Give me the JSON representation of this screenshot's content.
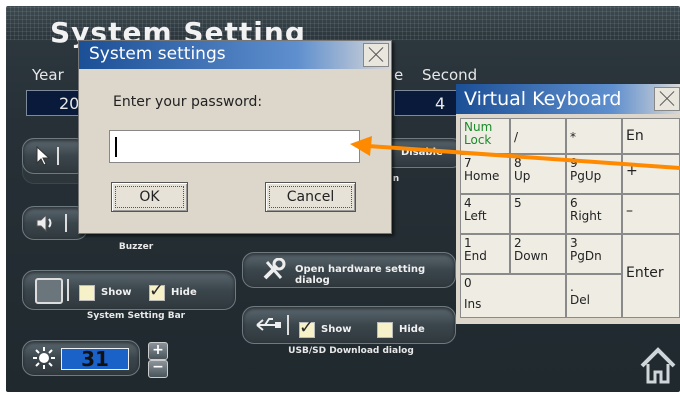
{
  "app": {
    "title": "System Setting",
    "labels": {
      "year": "Year",
      "second": "Second"
    },
    "values": {
      "year": "20",
      "second": "4"
    },
    "brightness": "31",
    "captions": {
      "buzzer": "Buzzer",
      "system_setting_bar": "System Setting Bar",
      "usb_dialog": "USB/SD Download dialog",
      "disable": "Disable",
      "n_fragment": "n"
    },
    "system_setting_bar": {
      "show": "Show",
      "hide": "Hide"
    },
    "usb_sd": {
      "show": "Show",
      "hide": "Hide"
    },
    "hardware_button": "Open hardware setting dialog"
  },
  "dialog": {
    "title": "System settings",
    "prompt": "Enter your password:",
    "password_value": "",
    "ok_label": "OK",
    "cancel_label": "Cancel"
  },
  "keyboard": {
    "title": "Virtual Keyboard",
    "keys": {
      "numlock": {
        "top": "Num",
        "bottom": "Lock"
      },
      "slash": "/",
      "star": "*",
      "en": "En",
      "k7": {
        "top": "7",
        "bottom": "Home"
      },
      "k8": {
        "top": "8",
        "bottom": "Up"
      },
      "k9": {
        "top": "9",
        "bottom": "PgUp"
      },
      "plus": "+",
      "k4": {
        "top": "4",
        "bottom": "Left"
      },
      "k5": "5",
      "k6": {
        "top": "6",
        "bottom": "Right"
      },
      "minus": "–",
      "k1": {
        "top": "1",
        "bottom": "End"
      },
      "k2": {
        "top": "2",
        "bottom": "Down"
      },
      "k3": {
        "top": "3",
        "bottom": "PgDn"
      },
      "enter": "Enter",
      "k0": {
        "top": "0",
        "bottom": "Ins"
      },
      "dot": {
        "top": ".",
        "bottom": "Del"
      }
    }
  },
  "colors": {
    "accent": "#ff8a00",
    "titlebar": "#1b4f96"
  },
  "icons": [
    "cursor-icon",
    "speaker-icon",
    "window-icon",
    "wrench-screwdriver-icon",
    "usb-icon",
    "brightness-icon",
    "plus-icon",
    "minus-icon",
    "home-icon",
    "close-icon"
  ]
}
